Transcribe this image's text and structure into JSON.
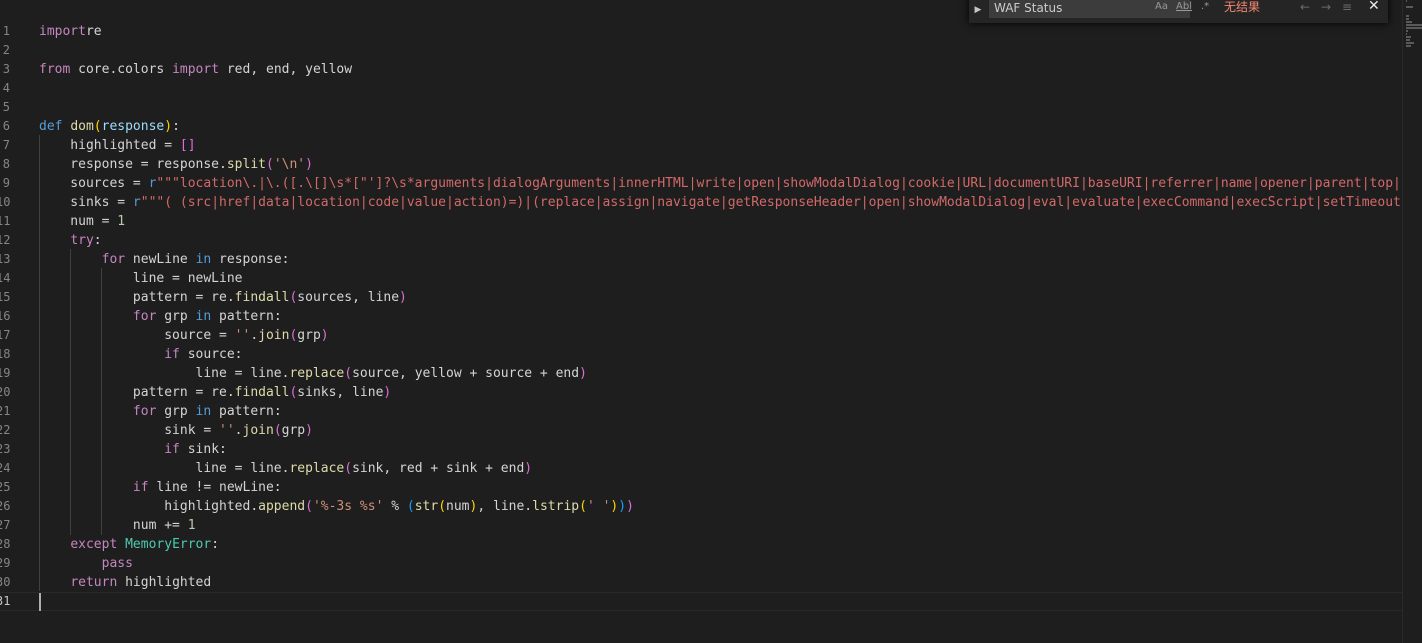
{
  "find_widget": {
    "query": "WAF Status",
    "match_case_label": "Aa",
    "whole_word_label": "Abl",
    "regex_label": ".*",
    "result_text": "无结果",
    "prev_glyph": "←",
    "next_glyph": "→",
    "selection_glyph": "≡",
    "close_glyph": "✕",
    "toggle_glyph": "▶"
  },
  "colors": {
    "background": "#1e1e1e",
    "keyword": "#c586c0",
    "storage": "#569cd6",
    "function": "#dcdcaa",
    "string": "#ce9178",
    "regex": "#d16969",
    "no_results": "#f48771"
  },
  "line_numbers": [
    "1",
    "2",
    "3",
    "4",
    "5",
    "6",
    "7",
    "8",
    "9",
    "10",
    "11",
    "12",
    "13",
    "14",
    "15",
    "16",
    "17",
    "18",
    "19",
    "20",
    "21",
    "22",
    "23",
    "24",
    "25",
    "26",
    "27",
    "28",
    "29",
    "30",
    "31"
  ],
  "code_lines": [
    [
      [
        "kw",
        "import"
      ],
      [
        "",
        "re"
      ]
    ],
    [],
    [
      [
        "kw",
        "from"
      ],
      [
        "",
        " core.colors "
      ],
      [
        "kw",
        "import"
      ],
      [
        "",
        " red, end, yellow"
      ]
    ],
    [],
    [],
    [
      [
        "kw2",
        "def"
      ],
      [
        "",
        " "
      ],
      [
        "fn",
        "dom"
      ],
      [
        "pn",
        "("
      ],
      [
        "prm",
        "response"
      ],
      [
        "pn",
        ")"
      ],
      [
        "",
        ":"
      ]
    ],
    [
      [
        "",
        "    highlighted = "
      ],
      [
        "pn2",
        "[]"
      ]
    ],
    [
      [
        "",
        "    response = response."
      ],
      [
        "fn",
        "split"
      ],
      [
        "pn2",
        "("
      ],
      [
        "str",
        "'\\n'"
      ],
      [
        "pn2",
        ")"
      ]
    ],
    [
      [
        "",
        "    sources = "
      ],
      [
        "kw2",
        "r"
      ],
      [
        "rx",
        "\"\"\"location\\.|\\.([.\\[]\\s*[\"']?\\s*arguments|dialogArguments|innerHTML|write|open|showModalDialog|cookie|URL|documentURI|baseURI|referrer|name|opener|parent|top|content"
      ]
    ],
    [
      [
        "",
        "    sinks = "
      ],
      [
        "kw2",
        "r"
      ],
      [
        "rx",
        "\"\"\"( (src|href|data|location|code|value|action)=)|(replace|assign|navigate|getResponseHeader|open|showModalDialog|eval|evaluate|execCommand|execScript|setTimeout|setInterval"
      ]
    ],
    [
      [
        "",
        "    num = "
      ],
      [
        "num",
        "1"
      ]
    ],
    [
      [
        "",
        "    "
      ],
      [
        "kw",
        "try"
      ],
      [
        "",
        ":"
      ]
    ],
    [
      [
        "",
        "        "
      ],
      [
        "kw",
        "for"
      ],
      [
        "",
        " newLine "
      ],
      [
        "kw2",
        "in"
      ],
      [
        "",
        " response:"
      ]
    ],
    [
      [
        "",
        "            line = newLine"
      ]
    ],
    [
      [
        "",
        "            pattern = re."
      ],
      [
        "fn",
        "findall"
      ],
      [
        "pn2",
        "("
      ],
      [
        "",
        "sources, line"
      ],
      [
        "pn2",
        ")"
      ]
    ],
    [
      [
        "",
        "            "
      ],
      [
        "kw",
        "for"
      ],
      [
        "",
        " grp "
      ],
      [
        "kw2",
        "in"
      ],
      [
        "",
        " pattern:"
      ]
    ],
    [
      [
        "",
        "                source = "
      ],
      [
        "str",
        "''"
      ],
      [
        "",
        "."
      ],
      [
        "fn",
        "join"
      ],
      [
        "pn2",
        "("
      ],
      [
        "",
        "grp"
      ],
      [
        "pn2",
        ")"
      ]
    ],
    [
      [
        "",
        "                "
      ],
      [
        "kw",
        "if"
      ],
      [
        "",
        " source:"
      ]
    ],
    [
      [
        "",
        "                    line = line."
      ],
      [
        "fn",
        "replace"
      ],
      [
        "pn2",
        "("
      ],
      [
        "",
        "source, yellow + source + end"
      ],
      [
        "pn2",
        ")"
      ]
    ],
    [
      [
        "",
        "            pattern = re."
      ],
      [
        "fn",
        "findall"
      ],
      [
        "pn2",
        "("
      ],
      [
        "",
        "sinks, line"
      ],
      [
        "pn2",
        ")"
      ]
    ],
    [
      [
        "",
        "            "
      ],
      [
        "kw",
        "for"
      ],
      [
        "",
        " grp "
      ],
      [
        "kw2",
        "in"
      ],
      [
        "",
        " pattern:"
      ]
    ],
    [
      [
        "",
        "                sink = "
      ],
      [
        "str",
        "''"
      ],
      [
        "",
        "."
      ],
      [
        "fn",
        "join"
      ],
      [
        "pn2",
        "("
      ],
      [
        "",
        "grp"
      ],
      [
        "pn2",
        ")"
      ]
    ],
    [
      [
        "",
        "                "
      ],
      [
        "kw",
        "if"
      ],
      [
        "",
        " sink:"
      ]
    ],
    [
      [
        "",
        "                    line = line."
      ],
      [
        "fn",
        "replace"
      ],
      [
        "pn2",
        "("
      ],
      [
        "",
        "sink, red + sink + end"
      ],
      [
        "pn2",
        ")"
      ]
    ],
    [
      [
        "",
        "            "
      ],
      [
        "kw",
        "if"
      ],
      [
        "",
        " line != newLine:"
      ]
    ],
    [
      [
        "",
        "                highlighted."
      ],
      [
        "fn",
        "append"
      ],
      [
        "pn2",
        "("
      ],
      [
        "str",
        "'%-3s %s'"
      ],
      [
        "",
        " % "
      ],
      [
        "pn3",
        "("
      ],
      [
        "fn",
        "str"
      ],
      [
        "pn",
        "("
      ],
      [
        "",
        "num"
      ],
      [
        "pn",
        ")"
      ],
      [
        "",
        ", line."
      ],
      [
        "fn",
        "lstrip"
      ],
      [
        "pn",
        "("
      ],
      [
        "str",
        "' '"
      ],
      [
        "pn",
        ")"
      ],
      [
        "pn3",
        ")"
      ],
      [
        "pn2",
        ")"
      ]
    ],
    [
      [
        "",
        "            num += "
      ],
      [
        "num",
        "1"
      ]
    ],
    [
      [
        "",
        "    "
      ],
      [
        "kw",
        "except"
      ],
      [
        "",
        " "
      ],
      [
        "cls",
        "MemoryError"
      ],
      [
        "",
        ":"
      ]
    ],
    [
      [
        "",
        "        "
      ],
      [
        "kw",
        "pass"
      ]
    ],
    [
      [
        "",
        "    "
      ],
      [
        "kw",
        "return"
      ],
      [
        "",
        " highlighted"
      ]
    ],
    []
  ]
}
